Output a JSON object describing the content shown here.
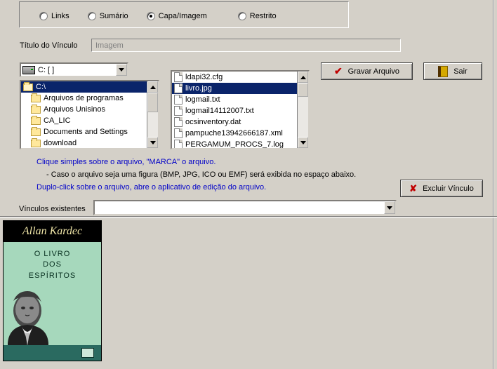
{
  "radios": {
    "links": "Links",
    "sumario": "Sumário",
    "capa": "Capa/Imagem",
    "restrito": "Restrito",
    "selected": "capa"
  },
  "titulo": {
    "label": "Título do Vínculo",
    "value": "Imagem"
  },
  "drive": {
    "text": "C: [ ]"
  },
  "folders": {
    "root": "C:\\",
    "items": [
      "Arquivos de programas",
      "Arquivos Unisinos",
      "CA_LIC",
      "Documents and Settings",
      "download"
    ]
  },
  "files": {
    "items": [
      "ldapi32.cfg",
      "livro.jpg",
      "logmail.txt",
      "logmail14112007.txt",
      "ocsinventory.dat",
      "pampuche13942666187.xml",
      "PERGAMUM_PROCS_7.log"
    ],
    "selected_index": 1
  },
  "buttons": {
    "gravar": "Gravar Arquivo",
    "sair": "Sair",
    "excluir": "Excluir Vínculo"
  },
  "hints": {
    "l1": "Clique simples sobre o arquivo, \"MARCA\" o arquivo.",
    "l2": "- Caso o arquivo seja uma figura (BMP, JPG, ICO ou EMF) será exibida no espaço abaixo.",
    "l3": "Duplo-click sobre o arquivo, abre o aplicativo de edição do arquivo."
  },
  "vinculos": {
    "label": "Vínculos existentes",
    "value": ""
  },
  "book": {
    "author": "Allan Kardec",
    "title_l1": "O LIVRO",
    "title_l2": "DOS",
    "title_l3": "ESPÍRITOS"
  }
}
